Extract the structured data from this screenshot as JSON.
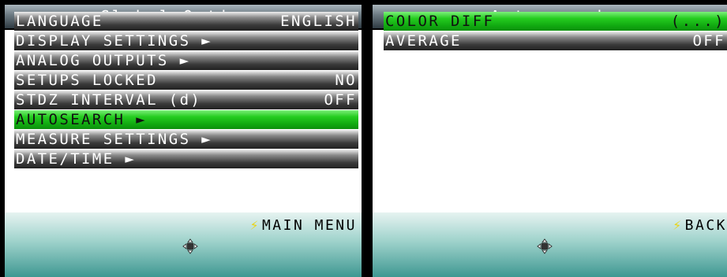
{
  "left": {
    "title": "Global Options",
    "items": [
      {
        "label": "LANGUAGE",
        "value": "ENGLISH",
        "selected": false
      },
      {
        "label": "DISPLAY SETTINGS ►",
        "value": "",
        "selected": false
      },
      {
        "label": "ANALOG OUTPUTS ►",
        "value": "",
        "selected": false
      },
      {
        "label": "SETUPS LOCKED",
        "value": "NO",
        "selected": false
      },
      {
        "label": "STDZ INTERVAL (d)",
        "value": "OFF",
        "selected": false
      },
      {
        "label": "AUTOSEARCH ►",
        "value": "",
        "selected": true
      },
      {
        "label": "MEASURE SETTINGS ►",
        "value": "",
        "selected": false
      },
      {
        "label": "DATE/TIME ►",
        "value": "",
        "selected": false
      }
    ],
    "softkey": "MAIN MENU"
  },
  "right": {
    "title": "Autosearch",
    "items": [
      {
        "label": "COLOR DIFF",
        "value": "(...)",
        "selected": true
      },
      {
        "label": "AVERAGE",
        "value": "OFF",
        "selected": false
      }
    ],
    "softkey": "BACK"
  },
  "icons": {
    "softkey": "lightning-icon",
    "nav": "dpad-icon"
  },
  "colors": {
    "selected_row": "#22c41c",
    "row": "#3a3a3a",
    "bottom_bar": "#3f9892",
    "bolt": "#e9d41a"
  }
}
